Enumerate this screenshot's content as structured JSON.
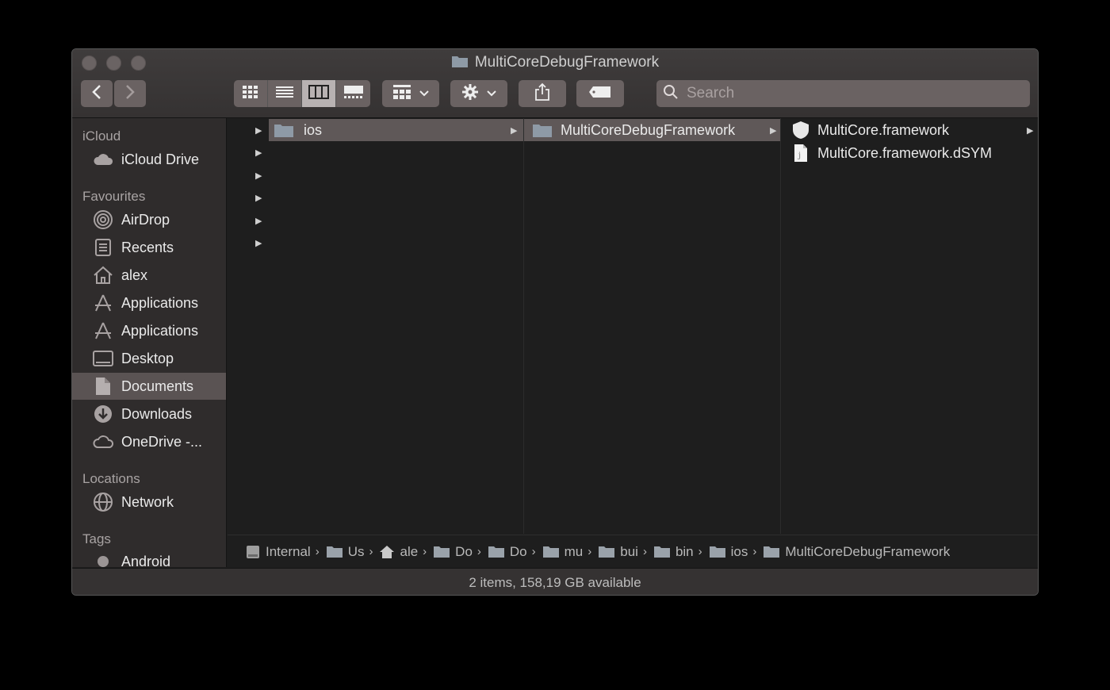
{
  "window": {
    "title": "MultiCoreDebugFramework"
  },
  "toolbar": {
    "back_icon": "chevron-left-icon",
    "forward_icon": "chevron-right-icon",
    "view_modes": [
      "icon-view",
      "list-view",
      "column-view",
      "gallery-view"
    ],
    "active_view": "column-view",
    "search_placeholder": "Search"
  },
  "sidebar": {
    "sections": {
      "icloud": "iCloud",
      "favourites": "Favourites",
      "locations": "Locations",
      "tags": "Tags"
    },
    "icloud_items": [
      {
        "label": "iCloud Drive",
        "icon": "cloud-icon"
      }
    ],
    "favourites_items": [
      {
        "label": "AirDrop",
        "icon": "airdrop-icon"
      },
      {
        "label": "Recents",
        "icon": "recents-icon"
      },
      {
        "label": "alex",
        "icon": "home-icon"
      },
      {
        "label": "Applications",
        "icon": "applications-icon"
      },
      {
        "label": "Applications",
        "icon": "applications-icon"
      },
      {
        "label": "Desktop",
        "icon": "desktop-icon"
      },
      {
        "label": "Documents",
        "icon": "documents-icon",
        "selected": true
      },
      {
        "label": "Downloads",
        "icon": "downloads-icon"
      },
      {
        "label": "OneDrive -...",
        "icon": "cloud-icon"
      }
    ],
    "locations_items": [
      {
        "label": "Network",
        "icon": "network-icon"
      }
    ],
    "tags_items": [
      {
        "label": "Android",
        "icon": "tag-dot-icon"
      }
    ]
  },
  "columns": {
    "col1": {
      "selected_item": "ios"
    },
    "col2": {
      "selected_item": "MultiCoreDebugFramework"
    },
    "col3": {
      "items": [
        "MultiCore.framework",
        "MultiCore.framework.dSYM"
      ]
    }
  },
  "pathbar": [
    {
      "label": "Internal",
      "icon": "disk-icon"
    },
    {
      "label": "Us",
      "icon": "folder-icon"
    },
    {
      "label": "ale",
      "icon": "home-icon"
    },
    {
      "label": "Do",
      "icon": "folder-icon"
    },
    {
      "label": "Do",
      "icon": "folder-icon"
    },
    {
      "label": "mu",
      "icon": "folder-icon"
    },
    {
      "label": "bui",
      "icon": "folder-icon"
    },
    {
      "label": "bin",
      "icon": "folder-icon"
    },
    {
      "label": "ios",
      "icon": "folder-icon"
    },
    {
      "label": "MultiCoreDebugFramework",
      "icon": "folder-icon"
    }
  ],
  "status": {
    "text": "2 items, 158,19 GB available"
  }
}
